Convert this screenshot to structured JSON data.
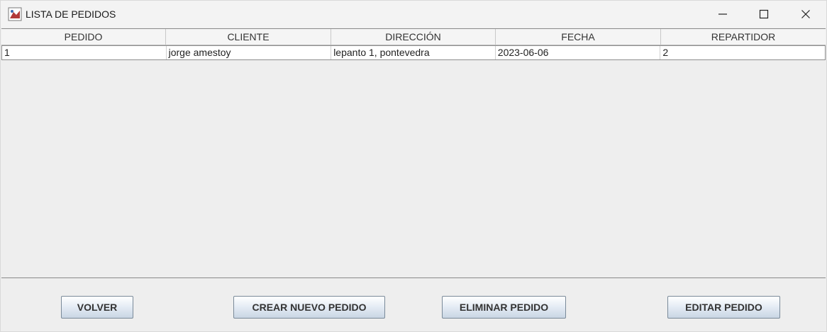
{
  "window": {
    "title": "LISTA DE PEDIDOS",
    "icon": "java-app-icon",
    "controls": [
      "minimize-icon",
      "maximize-icon",
      "close-icon"
    ]
  },
  "table": {
    "columns": [
      "PEDIDO",
      "CLIENTE",
      "DIRECCIÓN",
      "FECHA",
      "REPARTIDOR"
    ],
    "rows": [
      [
        "1",
        "jorge amestoy",
        "lepanto 1, pontevedra",
        "2023-06-06",
        "2"
      ]
    ]
  },
  "buttons": {
    "volver": "VOLVER",
    "crear": "CREAR NUEVO PEDIDO",
    "eliminar": "ELIMINAR PEDIDO",
    "editar": "EDITAR PEDIDO"
  }
}
